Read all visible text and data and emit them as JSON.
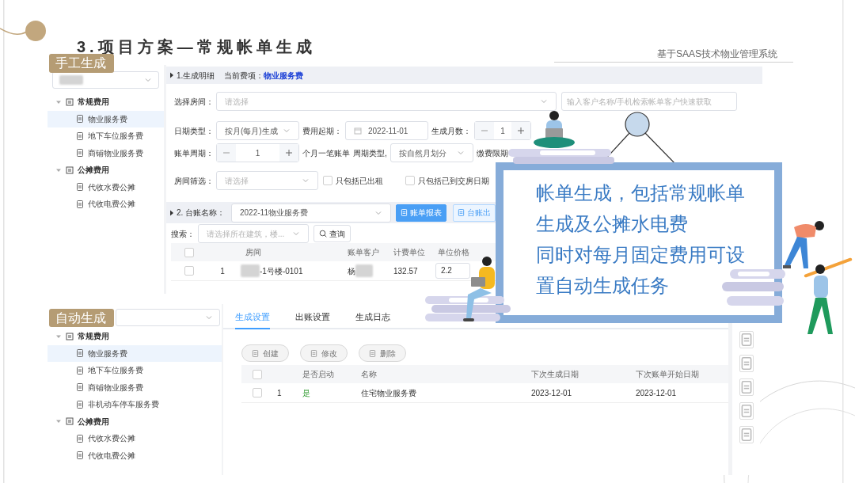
{
  "slide": {
    "title": "3.项目方案—常规帐单生成",
    "subtitle": "基于SAAS技术物业管理系统"
  },
  "manual": {
    "tag": "手工生成",
    "tree": [
      {
        "label": "常规费用",
        "selected": false,
        "expanded": true,
        "children": [
          {
            "label": "物业服务费",
            "selected": true
          },
          {
            "label": "地下车位服务费",
            "selected": false
          },
          {
            "label": "商铺物业服务费",
            "selected": false
          }
        ]
      },
      {
        "label": "公摊费用",
        "selected": false,
        "expanded": true,
        "children": [
          {
            "label": "代收水费公摊",
            "selected": false
          },
          {
            "label": "代收电费公摊",
            "selected": false
          }
        ]
      }
    ],
    "detail": {
      "heading": "1.生成明细",
      "current_label": "当前费项：",
      "current_value": "物业服务费",
      "room_label": "选择房间：",
      "room_placeholder": "请选择",
      "customer_placeholder": "输入客户名称/手机检索帐单客户快速获取",
      "date_type_label": "日期类型：",
      "date_type": "按月(每月)生成",
      "start_label": "费用起期：",
      "start_date": "2022-11-01",
      "months_label": "生成月数：",
      "months": "1",
      "cycle_label": "账单周期：",
      "cycle": "1",
      "cycle_unit": "个月一笔账单",
      "cycle_type_label": "周期类型,",
      "cycle_type": "按自然月划分",
      "due_label": "缴费限期",
      "filter_label": "房间筛选：",
      "filter_placeholder": "请选择",
      "filters": [
        {
          "label": "只包括已出租",
          "checked": false
        },
        {
          "label": "只包括已到交房日期",
          "checked": false
        }
      ]
    },
    "ledger": {
      "heading": "2. 台账名称：",
      "ledger": "2022-11物业服务费",
      "buttons": [
        {
          "label": "账单报表",
          "kind": "primary"
        },
        {
          "label": "台账出",
          "kind": "plain"
        }
      ],
      "search_label": "搜索：",
      "search_placeholder": "请选择所在建筑，楼...",
      "search_button": "查询",
      "columns": [
        "房间",
        "账单客户",
        "计费单位",
        "单位价格"
      ],
      "all_checked": false,
      "rows": [
        {
          "index": "1",
          "room": "-1号楼-0101",
          "customer": "杨",
          "unit": "132.57",
          "price": "2.2",
          "checked": false
        }
      ]
    }
  },
  "auto": {
    "tag": "自动生成",
    "tree": [
      {
        "label": "常规费用",
        "selected": false,
        "expanded": true,
        "children": [
          {
            "label": "物业服务费",
            "selected": true
          },
          {
            "label": "地下车位服务费",
            "selected": false
          },
          {
            "label": "商铺物业服务费",
            "selected": false
          },
          {
            "label": "非机动车停车服务费",
            "selected": false
          }
        ]
      },
      {
        "label": "公摊费用",
        "selected": false,
        "expanded": true,
        "children": [
          {
            "label": "代收水费公摊",
            "selected": false
          },
          {
            "label": "代收电费公摊",
            "selected": false
          }
        ]
      }
    ],
    "tabs": [
      {
        "label": "生成设置",
        "selected": true
      },
      {
        "label": "出账设置",
        "selected": false
      },
      {
        "label": "生成日志",
        "selected": false
      }
    ],
    "buttons": [
      "创建",
      "修改",
      "删除"
    ],
    "columns": [
      "是否启动",
      "名称",
      "下次生成日期",
      "下次账单开始日期"
    ],
    "all_checked": false,
    "rows": [
      {
        "index": "1",
        "enabled": "是",
        "name": "住宅物业服务费",
        "next_date": "2023-12-01",
        "next_start": "2023-12-01",
        "checked": false
      }
    ]
  },
  "callout": {
    "lines": [
      "帐单生成，包括常规帐单",
      "生成及公摊水电费",
      "同时对每月固定费用可设",
      "置自动生成任务"
    ]
  }
}
